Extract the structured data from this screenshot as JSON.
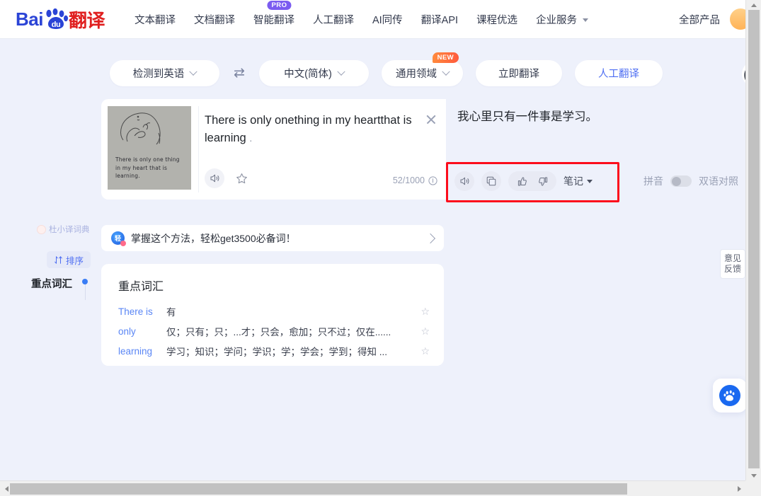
{
  "header": {
    "logo": {
      "bai": "Bai",
      "du": "du",
      "suffix": "翻译"
    },
    "nav": [
      {
        "label": "文本翻译",
        "badge": null,
        "caret": false
      },
      {
        "label": "文档翻译",
        "badge": null,
        "caret": false
      },
      {
        "label": "智能翻译",
        "badge": "PRO",
        "caret": false
      },
      {
        "label": "人工翻译",
        "badge": null,
        "caret": false
      },
      {
        "label": "AI同传",
        "badge": null,
        "caret": false
      },
      {
        "label": "翻译API",
        "badge": null,
        "caret": false
      },
      {
        "label": "课程优选",
        "badge": null,
        "caret": false
      },
      {
        "label": "企业服务",
        "badge": null,
        "caret": true
      }
    ],
    "all_products": "全部产品"
  },
  "langbar": {
    "source": "检测到英语",
    "target": "中文(简体)",
    "domain": "通用领域",
    "domain_badge": "NEW",
    "translate_button": "立即翻译",
    "human_button": "人工翻译",
    "swap_icon": "⇄"
  },
  "input_card": {
    "thumbnail_caption": "There is only one thing in my heart that is learning.",
    "text": "There is only onething in my heartthat is learning",
    "trailing_period": ".",
    "char_count": "52/1000",
    "speaker_icon": "speaker-icon",
    "favorite_icon": "star-icon",
    "clear_icon": "close-icon",
    "info_icon": "info-icon"
  },
  "output_card": {
    "text": "我心里只有一件事是学习。",
    "toolbar": {
      "speaker_icon": "speaker-icon",
      "copy_icon": "copy-icon",
      "like_icon": "thumbs-up-icon",
      "dislike_icon": "thumbs-down-icon",
      "note_label": "笔记"
    },
    "pinyin_label": "拼音",
    "bilingual_label": "双语对照",
    "toggle_state": "off"
  },
  "promo": {
    "icon": "chat-bubble-icon",
    "text": "掌握这个方法，轻松get3500必备词！",
    "arrow_icon": "chevron-right-icon"
  },
  "vocabulary": {
    "title": "重点词汇",
    "rows": [
      {
        "term": "There is",
        "definition": "有",
        "star": "☆"
      },
      {
        "term": "only",
        "definition": "仅；只有；只；...才；只会，愈加；只不过；仅在......",
        "star": "☆"
      },
      {
        "term": "learning",
        "definition": "学习；知识；学问；学识；学；学会；学到；得知 ...",
        "star": "☆"
      }
    ]
  },
  "sidebar": {
    "dictionary_chip": "杜小译词典",
    "sort_label": "排序",
    "sort_icon": "sort-icon",
    "section_label": "重点词汇"
  },
  "widgets": {
    "feedback_line1": "意见",
    "feedback_line2": "反馈",
    "fab_icon": "baidu-logo-icon"
  },
  "colors": {
    "accent_blue": "#4e6ef2",
    "brand_red": "#e02020",
    "highlight_red": "#fc0d1c",
    "page_bg": "#eef1fb",
    "pro_purple": "#7b5cf0",
    "new_orange": "#ff6a3d"
  }
}
